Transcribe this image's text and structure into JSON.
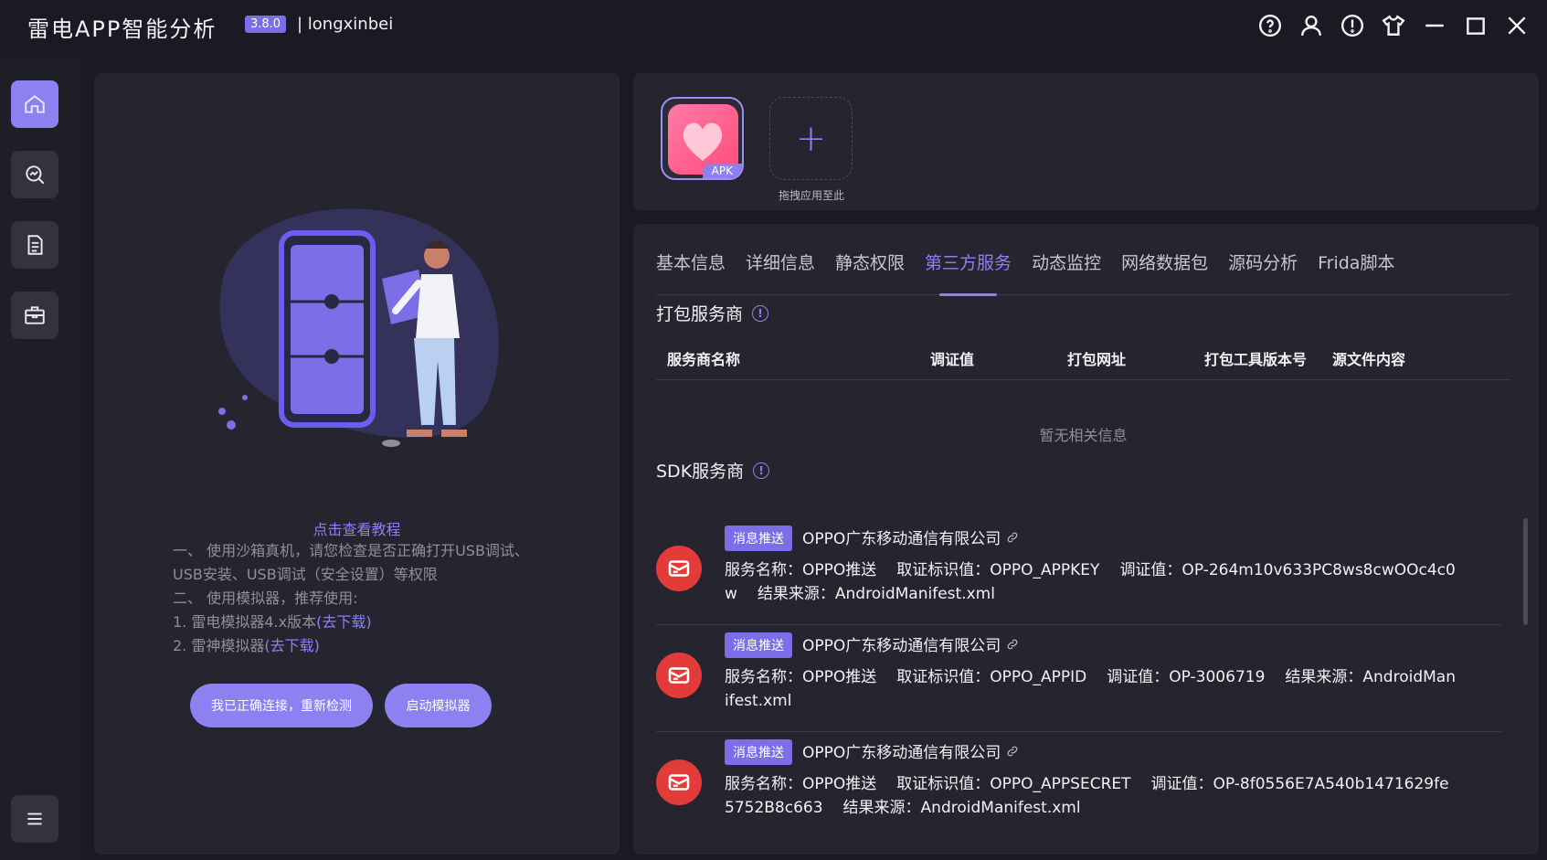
{
  "app": {
    "title": "雷电APP智能分析",
    "version": "3.8.0",
    "user": "| longxinbei"
  },
  "window_controls": [
    "help-icon",
    "user-icon",
    "info-icon",
    "skin-icon",
    "minimize-icon",
    "maximize-icon",
    "close-icon"
  ],
  "sidebar": {
    "items": [
      {
        "icon": "home-icon",
        "active": true
      },
      {
        "icon": "analysis-icon",
        "active": false
      },
      {
        "icon": "document-icon",
        "active": false
      },
      {
        "icon": "toolbox-icon",
        "active": false
      }
    ],
    "menu_icon": "menu-icon"
  },
  "left_panel": {
    "tutorial_link": "点击查看教程",
    "instructions": [
      "一、 使用沙箱真机，请您检查是否正确打开USB调试、USB安装、USB调试（安全设置）等权限",
      "二、 使用模拟器，推荐使用:"
    ],
    "emulators": [
      {
        "text": "1. 雷电模拟器4.x版本",
        "link": "(去下载)"
      },
      {
        "text": "2. 雷神模拟器",
        "link": "(去下载)"
      }
    ],
    "buttons": {
      "reconnect": "我已正确连接，重新检测",
      "launch": "启动模拟器"
    }
  },
  "apps_panel": {
    "apk_tag": "APK",
    "drag_label": "拖拽应用至此"
  },
  "tabs": [
    "基本信息",
    "详细信息",
    "静态权限",
    "第三方服务",
    "动态监控",
    "网络数据包",
    "源码分析",
    "Frida脚本"
  ],
  "active_tab": 3,
  "packaging": {
    "title": "打包服务商",
    "columns": [
      "服务商名称",
      "调证值",
      "打包网址",
      "打包工具版本号",
      "源文件内容"
    ],
    "empty": "暂无相关信息"
  },
  "sdk": {
    "title": "SDK服务商",
    "items": [
      {
        "tag": "消息推送",
        "company": "OPPO广东移动通信有限公司",
        "service": "服务名称：OPPO推送",
        "identifier": "取证标识值：OPPO_APPKEY",
        "value": "调证值：OP-264m10v633PC8ws8cwOOc4c0w",
        "source": "结果来源：AndroidManifest.xml"
      },
      {
        "tag": "消息推送",
        "company": "OPPO广东移动通信有限公司",
        "service": "服务名称：OPPO推送",
        "identifier": "取证标识值：OPPO_APPID",
        "value": "调证值：OP-3006719",
        "source": "结果来源：AndroidManifest.xml"
      },
      {
        "tag": "消息推送",
        "company": "OPPO广东移动通信有限公司",
        "service": "服务名称：OPPO推送",
        "identifier": "取证标识值：OPPO_APPSECRET",
        "value": "调证值：OP-8f0556E7A540b1471629fe5752B8c663",
        "source": "结果来源：AndroidManifest.xml"
      }
    ]
  }
}
